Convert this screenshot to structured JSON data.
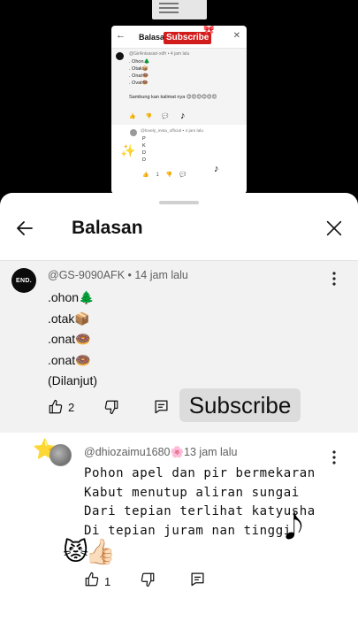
{
  "preview": {
    "header_title": "Balasan",
    "subscribe_badge": "Subscribe",
    "comment_author": "@GirAnisasari-xdfr • 4 jam lalu",
    "comment_lines": [
      ". Ohon🌲",
      ". Otak📦",
      ". Onat🍩",
      ". Ovat🍩"
    ],
    "comment_note": "Sambung kan kalimat nya",
    "comment_emojis": "😊😊😊😊😊😊",
    "reply_author": "@lovely_insta_official • 4 jam lalu",
    "reply_lines": [
      "P",
      "K",
      "D",
      "D"
    ],
    "reply_like_count": "1"
  },
  "sheet": {
    "title": "Balasan",
    "back_icon": "arrow-left-icon",
    "close_icon": "close-icon"
  },
  "parent_comment": {
    "avatar_text": "END.",
    "meta": "@GS-9090AFK • 14 jam lalu",
    "lines": [
      ".ohon🌲",
      ".otak📦",
      ".onat🍩",
      ".onat🍩",
      " (Dilanjut)"
    ],
    "like_count": "2",
    "overlay_label": "Subscribe"
  },
  "reply_comment": {
    "star_emoji": "⭐",
    "meta": "@dhiozaimu1680🌸13 jam lalu",
    "lines": [
      "Pohon apel dan pir bermekaran",
      "Kabut menutup aliran sungai",
      "Dari tepian terlihat katyusha",
      "Di tepian juram nan tinggi"
    ],
    "emoji": "😾👍🏻",
    "music_note": "𝅘𝅥𝅮",
    "like_count": "1"
  },
  "colors": {
    "background": "#000000",
    "sheet": "#ffffff",
    "highlight": "#f2f2f2",
    "meta_text": "#606060",
    "subscribe_overlay": "#dcdcdc",
    "subscribe_badge": "#d21b1b"
  }
}
